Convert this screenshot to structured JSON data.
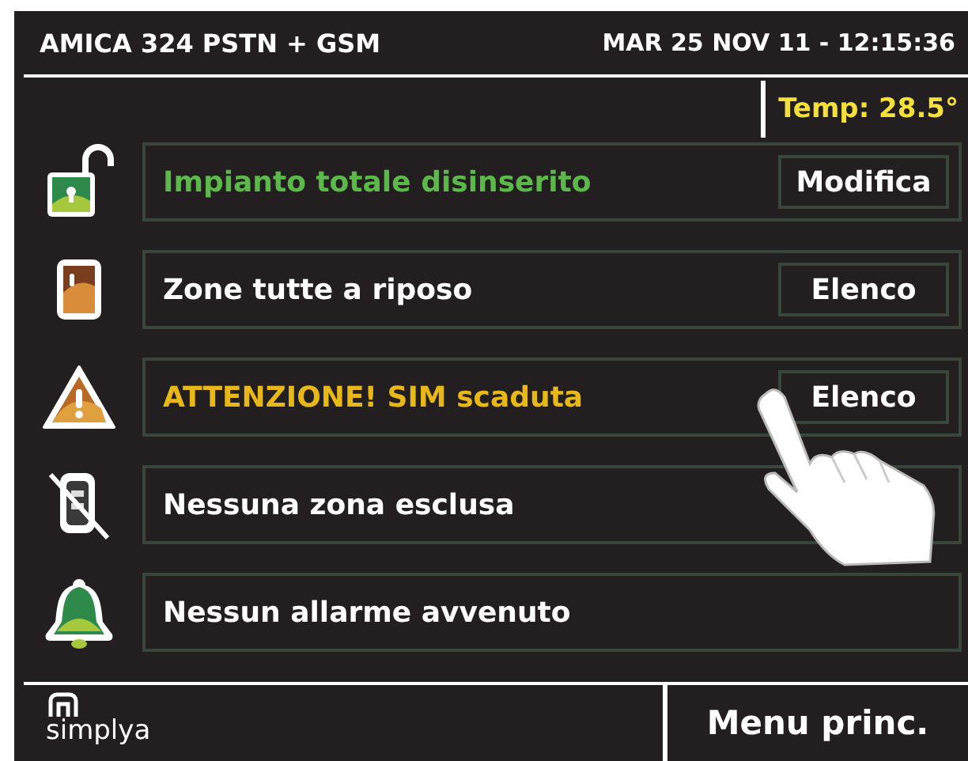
{
  "header": {
    "title": "AMICA 324 PSTN + GSM",
    "datetime": "MAR 25 NOV 11 - 12:15:36"
  },
  "temperature": "Temp: 28.5°",
  "rows": [
    {
      "kind": "ok",
      "text": "Impianto totale disinserito",
      "button": "Modifica"
    },
    {
      "kind": "normal",
      "text": "Zone tutte a riposo",
      "button": "Elenco"
    },
    {
      "kind": "warning",
      "text": "ATTENZIONE! SIM scaduta",
      "button": "Elenco"
    },
    {
      "kind": "normal",
      "text": "Nessuna zona esclusa"
    },
    {
      "kind": "normal",
      "text": "Nessun allarme avvenuto"
    }
  ],
  "footer": {
    "logo": "simplya",
    "menu_button": "Menu princ."
  }
}
